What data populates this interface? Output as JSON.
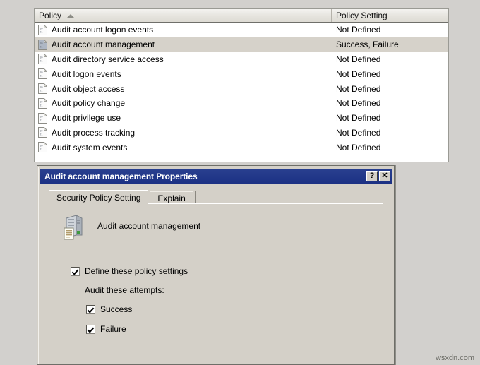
{
  "list": {
    "columns": [
      {
        "label": "Policy",
        "sort": "ascending"
      },
      {
        "label": "Policy Setting"
      }
    ],
    "rows": [
      {
        "policy": "Audit account logon events",
        "setting": "Not Defined",
        "selected": false
      },
      {
        "policy": "Audit account management",
        "setting": "Success, Failure",
        "selected": true
      },
      {
        "policy": "Audit directory service access",
        "setting": "Not Defined",
        "selected": false
      },
      {
        "policy": "Audit logon events",
        "setting": "Not Defined",
        "selected": false
      },
      {
        "policy": "Audit object access",
        "setting": "Not Defined",
        "selected": false
      },
      {
        "policy": "Audit policy change",
        "setting": "Not Defined",
        "selected": false
      },
      {
        "policy": "Audit privilege use",
        "setting": "Not Defined",
        "selected": false
      },
      {
        "policy": "Audit process tracking",
        "setting": "Not Defined",
        "selected": false
      },
      {
        "policy": "Audit system events",
        "setting": "Not Defined",
        "selected": false
      }
    ]
  },
  "dialog": {
    "title": "Audit account management Properties",
    "help_button": "?",
    "close_button": "✕",
    "tabs": [
      {
        "label": "Security Policy Setting",
        "active": true
      },
      {
        "label": "Explain",
        "active": false
      }
    ],
    "policy_name": "Audit account management",
    "define_checkbox": {
      "label": "Define these policy settings",
      "checked": true
    },
    "attempts_label": "Audit these attempts:",
    "options": [
      {
        "label": "Success",
        "checked": true
      },
      {
        "label": "Failure",
        "checked": true
      }
    ]
  },
  "watermark": "wsxdn.com",
  "colors": {
    "titlebar": "#1f3a8f",
    "dialog_face": "#d4d0c8",
    "selection": "#d6d2ca",
    "desktop": "#d2d0cd"
  }
}
